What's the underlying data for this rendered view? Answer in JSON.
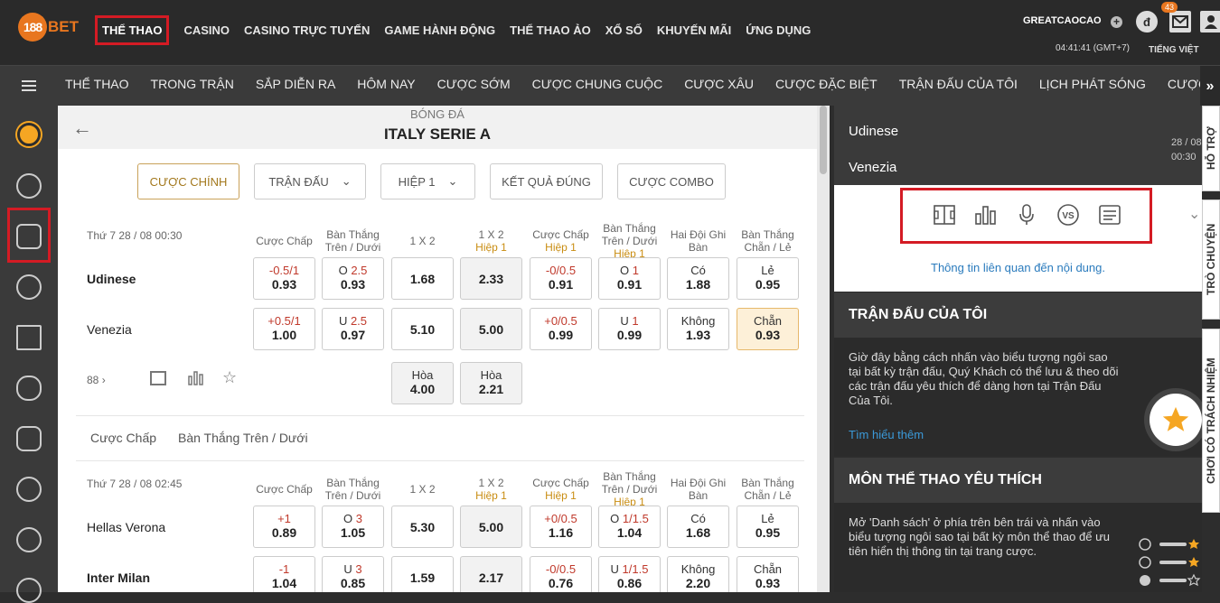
{
  "header": {
    "logo_circle": "188",
    "logo_text": "BET",
    "nav": [
      "THỂ THAO",
      "CASINO",
      "CASINO TRỰC TUYẾN",
      "GAME HÀNH ĐỘNG",
      "THỂ THAO ẢO",
      "XỔ SỐ",
      "KHUYẾN MÃI",
      "ỨNG DỤNG"
    ],
    "username": "GREATCAOCAO",
    "badge": "43",
    "clock": "04:41:41 (GMT+7)",
    "language": "TIẾNG VIỆT",
    "currency_icon": "đ"
  },
  "subnav": [
    "THỂ THAO",
    "TRONG TRẬN",
    "SẮP DIỄN RA",
    "HÔM NAY",
    "CƯỢC SỚM",
    "CƯỢC CHUNG CUỘC",
    "CƯỢC XÂU",
    "CƯỢC ĐẶC BIỆT",
    "TRẬN ĐẤU CỦA TÔI",
    "LỊCH PHÁT SÓNG",
    "CƯỢC"
  ],
  "main": {
    "sport": "BÓNG ĐÁ",
    "league": "ITALY SERIE A",
    "tabs": [
      "CƯỢC CHÍNH",
      "TRẬN ĐẤU",
      "HIỆP 1",
      "KẾT QUẢ ĐÚNG",
      "CƯỢC COMBO"
    ],
    "columns": [
      [
        "Cược Chấp"
      ],
      [
        "Bàn Thắng",
        "Trên / Dưới"
      ],
      [
        "1 X 2"
      ],
      [
        "1 X 2"
      ],
      [
        "Cược Chấp"
      ],
      [
        "Bàn Thắng",
        "Trên / Dưới"
      ],
      [
        "Hai Đội Ghi",
        "Bàn"
      ],
      [
        "Bàn Thắng",
        "Chẵn / Lẻ"
      ]
    ],
    "half_label": "Hiệp 1",
    "match1": {
      "date": "Thứ 7 28 / 08 00:30",
      "home": "Udinese",
      "away": "Venezia",
      "more": "88",
      "home_odds": [
        [
          "-0.5/1",
          "0.93"
        ],
        [
          "O 2.5",
          "0.93"
        ],
        [
          "",
          "1.68"
        ],
        [
          "",
          "2.33"
        ],
        [
          "-0/0.5",
          "0.91"
        ],
        [
          "O 1",
          "0.91"
        ],
        [
          "Có",
          "1.88"
        ],
        [
          "Lẻ",
          "0.95"
        ]
      ],
      "away_odds": [
        [
          "+0.5/1",
          "1.00"
        ],
        [
          "U 2.5",
          "0.97"
        ],
        [
          "",
          "5.10"
        ],
        [
          "",
          "5.00"
        ],
        [
          "+0/0.5",
          "0.99"
        ],
        [
          "U 1",
          "0.99"
        ],
        [
          "Không",
          "1.93"
        ],
        [
          "Chẵn",
          "0.93"
        ]
      ],
      "draw": [
        [
          "Hòa",
          "4.00"
        ],
        [
          "Hòa",
          "2.21"
        ]
      ]
    },
    "subtabs": [
      "Cược Chấp",
      "Bàn Thắng Trên / Dưới"
    ],
    "match2": {
      "date": "Thứ 7 28 / 08 02:45",
      "home": "Hellas Verona",
      "away": "Inter Milan",
      "home_odds": [
        [
          "+1",
          "0.89"
        ],
        [
          "O 3",
          "1.05"
        ],
        [
          "",
          "5.30"
        ],
        [
          "",
          "5.00"
        ],
        [
          "+0/0.5",
          "1.16"
        ],
        [
          "O 1/1.5",
          "1.04"
        ],
        [
          "Có",
          "1.68"
        ],
        [
          "Lẻ",
          "0.95"
        ]
      ],
      "away_odds": [
        [
          "-1",
          "1.04"
        ],
        [
          "U 3",
          "0.85"
        ],
        [
          "",
          "1.59"
        ],
        [
          "",
          "2.17"
        ],
        [
          "-0/0.5",
          "0.76"
        ],
        [
          "U 1/1.5",
          "0.86"
        ],
        [
          "Không",
          "2.20"
        ],
        [
          "Chẵn",
          "0.93"
        ]
      ]
    }
  },
  "right": {
    "home": "Udinese",
    "away": "Venezia",
    "date": "28 / 08",
    "time": "00:30",
    "info": "Thông tin liên quan đến nội dung.",
    "my_matches": {
      "title": "TRẬN ĐẤU CỦA TÔI",
      "body": "Giờ đây bằng cách nhấn vào biểu tượng ngôi sao tại bất kỳ trận đấu, Quý Khách có thể lưu & theo dõi các trận đấu yêu thích để dàng hơn tại Trận Đấu Của Tôi.",
      "link": "Tìm hiểu thêm"
    },
    "favorites": {
      "title": "MÔN THỂ THAO YÊU THÍCH",
      "body": "Mở 'Danh sách' ở phía trên bên trái và nhấn vào biểu tượng ngôi sao tại bất kỳ môn thể thao để ưu tiên hiển thị thông tin tại trang cược."
    }
  },
  "rail": [
    "HỖ TRỢ",
    "TRÒ CHUYỆN",
    "CHƠI CÓ TRÁCH NHIỆM"
  ]
}
